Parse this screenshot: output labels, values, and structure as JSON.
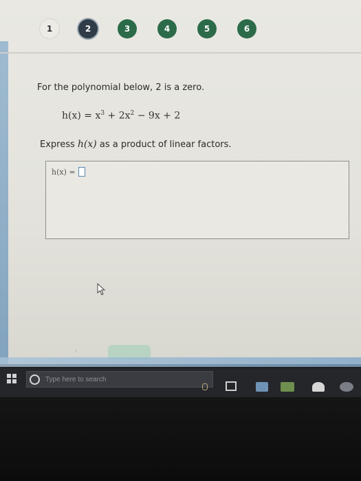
{
  "steps": [
    {
      "label": "1"
    },
    {
      "label": "2"
    },
    {
      "label": "3"
    },
    {
      "label": "4"
    },
    {
      "label": "5"
    },
    {
      "label": "6"
    }
  ],
  "question": {
    "intro": "For the polynomial below, 2 is a zero.",
    "equation": {
      "lhs": "h(x) = x",
      "exp1": "3",
      "mid": " + 2x",
      "exp2": "2",
      "rest": " − 9x + 2"
    },
    "express_prefix": "Express ",
    "express_func": "h(x)",
    "express_suffix": " as a product of linear factors."
  },
  "answer": {
    "label": "h(x) ="
  },
  "taskbar": {
    "search_placeholder": "Type here to search"
  },
  "icons": {
    "cursor": "mouse-cursor-icon",
    "windows": "windows-start-icon",
    "search": "cortana-ring-icon",
    "taskview": "task-view-icon"
  }
}
